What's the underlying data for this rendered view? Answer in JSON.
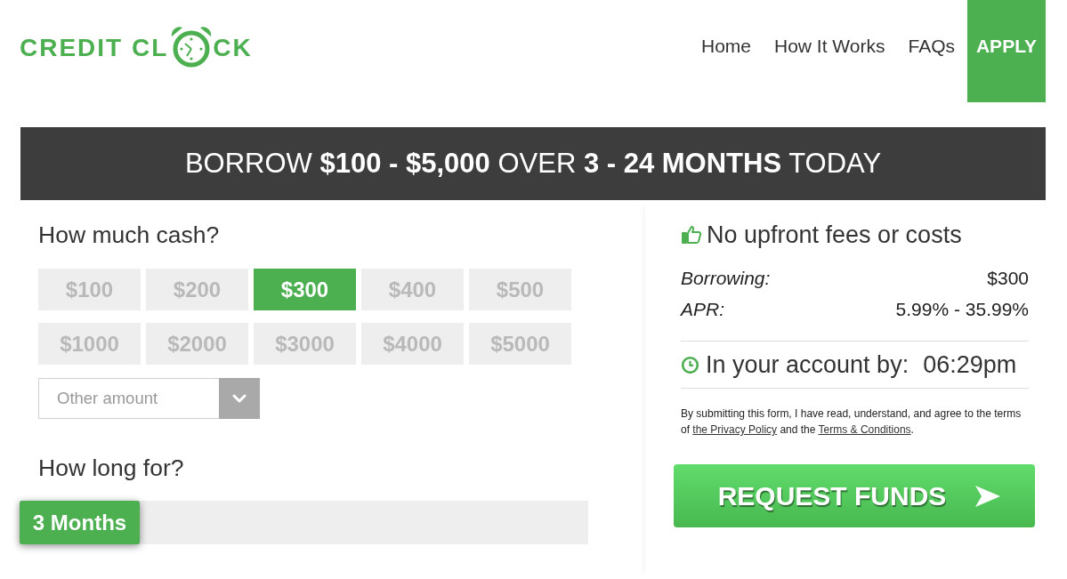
{
  "logo": {
    "lead": "CREDIT CL",
    "tail": "CK"
  },
  "nav": [
    {
      "label": "Home",
      "kind": "link"
    },
    {
      "label": "How It Works",
      "kind": "link"
    },
    {
      "label": "FAQs",
      "kind": "link"
    },
    {
      "label": "APPLY",
      "kind": "cta"
    }
  ],
  "banner": {
    "text": "BORROW **$100 - $5,000** OVER **3 - 24 MONTHS** TODAY"
  },
  "amount_section": {
    "heading": "How much cash?",
    "options": [
      {
        "label": "$100",
        "selected": false
      },
      {
        "label": "$200",
        "selected": false
      },
      {
        "label": "$300",
        "selected": true
      },
      {
        "label": "$400",
        "selected": false
      },
      {
        "label": "$500",
        "selected": false
      },
      {
        "label": "$1000",
        "selected": false
      },
      {
        "label": "$2000",
        "selected": false
      },
      {
        "label": "$3000",
        "selected": false
      },
      {
        "label": "$4000",
        "selected": false
      },
      {
        "label": "$5000",
        "selected": false
      }
    ],
    "other_amount": {
      "placeholder": "Other amount"
    }
  },
  "duration_section": {
    "heading": "How long for?",
    "slider": {
      "value_label": "3 Months",
      "level": 0
    }
  },
  "summary": {
    "headline": "No upfront fees or costs",
    "rows": [
      {
        "label": "Borrowing:",
        "value": "$300"
      },
      {
        "label": "APR:",
        "value": "5.99% - 35.99%"
      }
    ],
    "deposit": {
      "label": "In your account by:",
      "time": "06:29pm"
    },
    "terms": {
      "text_before": "By submitting this form, I have read, understand, and agree to the terms of ",
      "privacy_link": "the Privacy Policy",
      "text_middle": " and the ",
      "terms_link": "Terms & Conditions",
      "text_after": "."
    },
    "submit_button": "REQUEST FUNDS"
  }
}
